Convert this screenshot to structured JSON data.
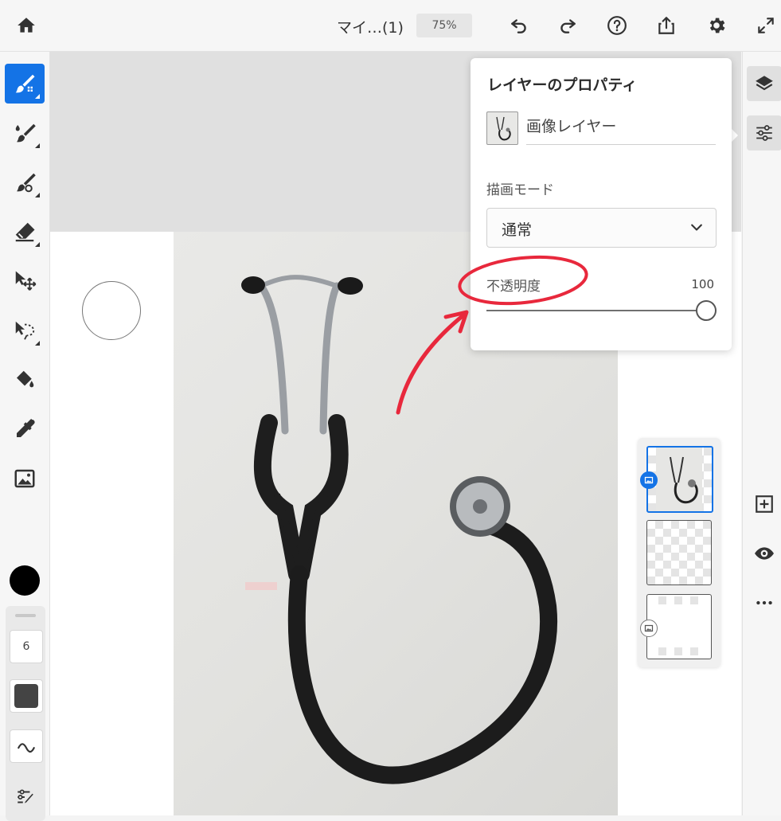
{
  "topbar": {
    "doc_title": "マイ…(1)",
    "zoom": "75%",
    "icons": [
      "home-icon",
      "undo-icon",
      "redo-icon",
      "help-icon",
      "share-icon",
      "settings-icon",
      "fullscreen-icon"
    ]
  },
  "left_toolbar": {
    "tools": [
      "pixel-brush-icon",
      "live-brush-icon",
      "vector-brush-icon",
      "eraser-icon",
      "transform-icon",
      "selection-icon",
      "fill-icon",
      "eyedropper-icon",
      "image-icon"
    ],
    "active_tool": "pixel-brush-icon",
    "color": "#000000",
    "brush_size": "6"
  },
  "properties_panel": {
    "title": "レイヤーのプロパティ",
    "layer_name": "画像レイヤー",
    "blend_mode_label": "描画モード",
    "blend_mode_value": "通常",
    "opacity_label": "不透明度",
    "opacity_value": "100",
    "opacity_fraction": 1.0
  },
  "layers": {
    "count": 3,
    "selected_index": 0
  },
  "colors": {
    "accent": "#1473e6",
    "annotation": "#e8283c"
  }
}
